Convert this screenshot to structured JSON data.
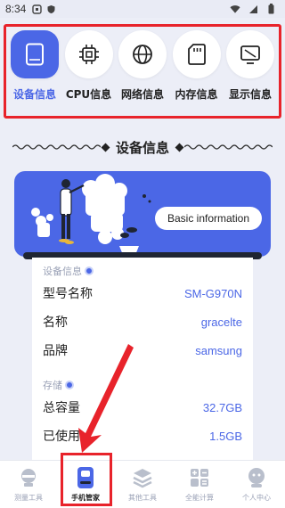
{
  "status_bar": {
    "time": "8:34"
  },
  "categories": [
    {
      "label": "设备信息",
      "icon": "tablet-icon",
      "active": true
    },
    {
      "label": "CPU信息",
      "icon": "cpu-icon",
      "active": false
    },
    {
      "label": "网络信息",
      "icon": "globe-icon",
      "active": false
    },
    {
      "label": "内存信息",
      "icon": "sd-card-icon",
      "active": false
    },
    {
      "label": "显示信息",
      "icon": "display-icon",
      "active": false
    }
  ],
  "section": {
    "title": "设备信息"
  },
  "banner": {
    "button_label": "Basic information"
  },
  "device": {
    "group_title": "设备信息",
    "rows": [
      {
        "key": "型号名称",
        "value": "SM-G970N"
      },
      {
        "key": "名称",
        "value": "gracelte"
      },
      {
        "key": "品牌",
        "value": "samsung"
      }
    ]
  },
  "storage": {
    "group_title": "存储",
    "rows": [
      {
        "key": "总容量",
        "value": "32.7GB"
      },
      {
        "key": "已使用",
        "value": "1.5GB"
      }
    ]
  },
  "bottom_nav": [
    {
      "label": "测量工具",
      "icon": "ruler-tools-icon",
      "active": false
    },
    {
      "label": "手机管家",
      "icon": "phone-manager-icon",
      "active": true
    },
    {
      "label": "其他工具",
      "icon": "layers-icon",
      "active": false
    },
    {
      "label": "全能计算",
      "icon": "calculator-icon",
      "active": false
    },
    {
      "label": "个人中心",
      "icon": "user-icon",
      "active": false
    }
  ],
  "colors": {
    "accent": "#4b67e6",
    "highlight": "#e8232b",
    "background": "#eceef7"
  }
}
